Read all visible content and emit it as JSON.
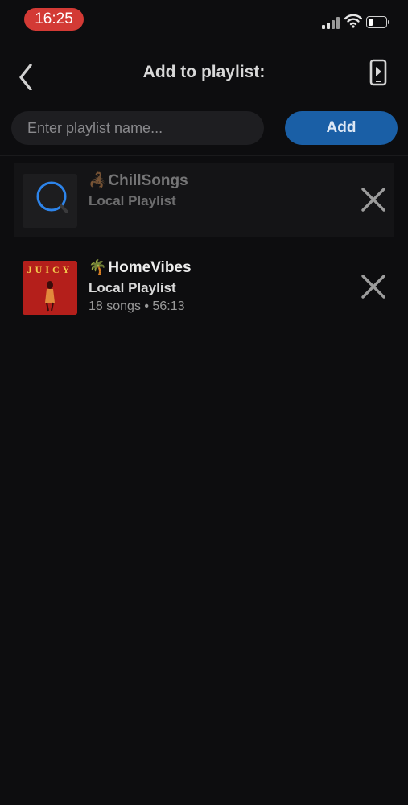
{
  "status_bar": {
    "time": "16:25"
  },
  "header": {
    "title": "Add to playlist:"
  },
  "new_playlist": {
    "placeholder": "Enter playlist name...",
    "add_label": "Add"
  },
  "playlists": [
    {
      "emoji": "🦂",
      "name": "ChillSongs",
      "type": "Local Playlist",
      "meta": ""
    },
    {
      "emoji": "🌴",
      "name": "HomeVibes",
      "type": "Local Playlist",
      "meta": "18 songs • 56:13",
      "cover_text": "JUICY"
    }
  ],
  "colors": {
    "accent": "#1a5fa6",
    "time_pill": "#d33a35",
    "background": "#0d0d0f",
    "album_cover": "#b41f1b"
  }
}
